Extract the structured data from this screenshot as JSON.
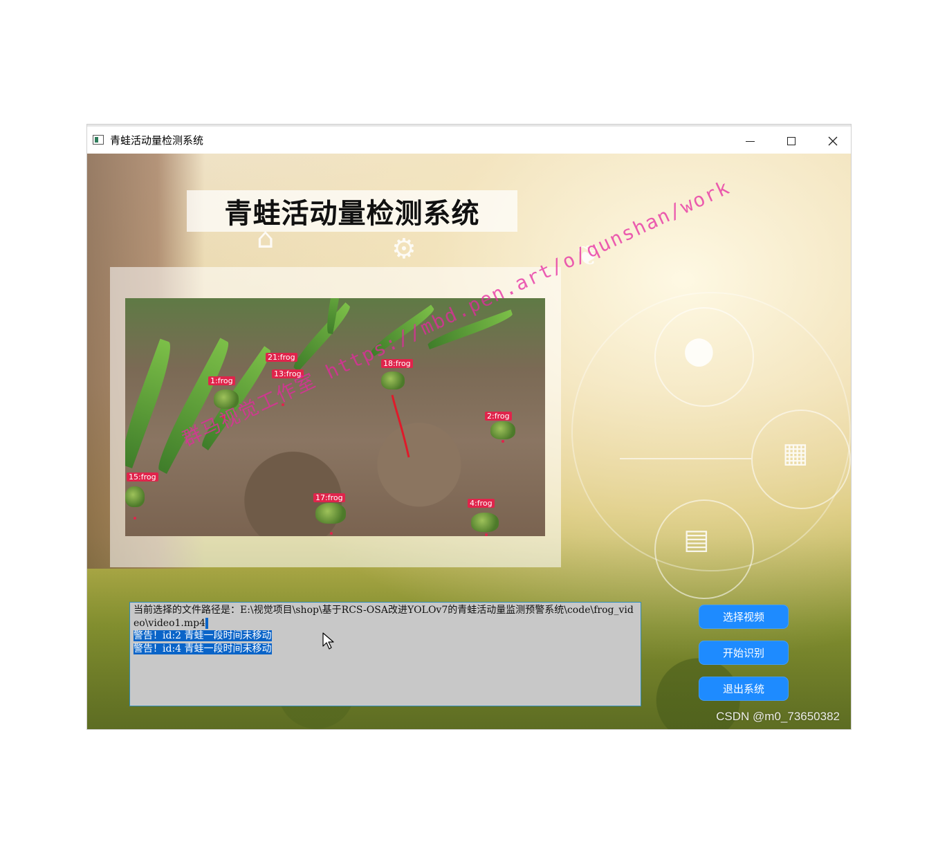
{
  "window": {
    "title": "青蛙活动量检测系统",
    "controls": {
      "minimize_icon": "minimize-icon",
      "maximize_icon": "maximize-icon",
      "close_icon": "close-icon"
    }
  },
  "header": {
    "title": "青蛙活动量检测系统"
  },
  "video": {
    "detections": [
      "21:frog",
      "1:frog",
      "13:frog",
      "18:frog",
      "2:frog",
      "15:frog",
      "17:frog",
      "4:frog"
    ]
  },
  "overlay_watermark": "群马视觉工作室 https://mbd.pen.art/o/qunshan/work",
  "log": {
    "lines": [
      "当前选择的文件路径是：E:\\视觉项目\\shop\\基于RCS-OSA改进YOLOv7的青蛙活动量监测预警系统\\code\\frog_video\\video1.mp4",
      "警告！id:2 青蛙一段时间未移动",
      "警告！id:4 青蛙一段时间未移动"
    ]
  },
  "buttons": {
    "select_video": "选择视频",
    "start_detect": "开始识别",
    "exit_system": "退出系统"
  },
  "footer_watermark": "CSDN @m0_73650382",
  "colors": {
    "button_bg": "#1e8bff",
    "detection_label": "#e0244b",
    "selection": "#0a64c8",
    "log_bg": "#c8c8c8"
  }
}
